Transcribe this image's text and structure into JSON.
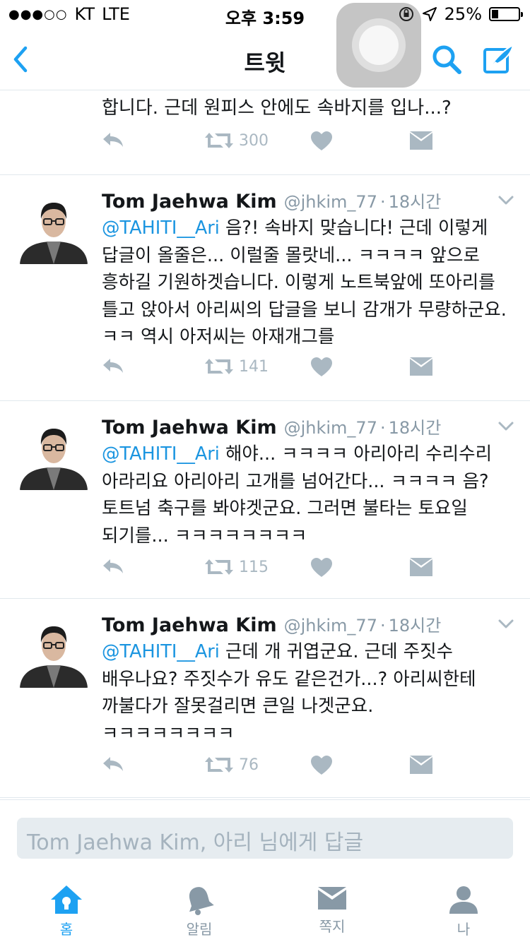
{
  "status_bar": {
    "signal": "●●●○○",
    "carrier": "KT",
    "network": "LTE",
    "time": "오후 3:59",
    "battery": "25%",
    "battery_level": 0.25
  },
  "nav": {
    "title": "트윗",
    "back_icon": "chevron-left-icon",
    "search_icon": "search-icon",
    "compose_icon": "compose-icon",
    "accent": "#1da1f2"
  },
  "partial_tweet": {
    "text": "합니다. 근데 원피스 안에도 속바지를 입나...?",
    "retweets": "300"
  },
  "tweets": [
    {
      "name": "Tom Jaehwa Kim",
      "handle": "@jhkim_77",
      "separator": "·",
      "time": "18시간",
      "mention": "@TAHITI__Ari",
      "body": " 음?! 속바지 맞습니다! 근데 이렇게 답글이 올줄은... 이럴줄 몰랏네... ㅋㅋㅋㅋ 앞으로 흥하길 기원하겟습니다. 이렇게 노트북앞에 또아리를 틀고 앉아서 아리씨의 답글을 보니 감개가 무량하군요. ㅋㅋ 역시 아저씨는 아재개그를",
      "retweets": "141"
    },
    {
      "name": "Tom Jaehwa Kim",
      "handle": "@jhkim_77",
      "separator": "·",
      "time": "18시간",
      "mention": "@TAHITI__Ari",
      "body": " 해야... ㅋㅋㅋㅋ 아리아리 수리수리 아라리요 아리아리 고개를 넘어간다... ㅋㅋㅋㅋ 음? 토트넘 축구를 봐야겟군요. 그러면 불타는 토요일 되기를... ㅋㅋㅋㅋㅋㅋㅋㅋ",
      "retweets": "115"
    },
    {
      "name": "Tom Jaehwa Kim",
      "handle": "@jhkim_77",
      "separator": "·",
      "time": "18시간",
      "mention": "@TAHITI__Ari",
      "body": " 근데 개 귀엽군요. 근데 주짓수 배우나요? 주짓수가 유도 같은건가...? 아리씨한테 까불다가 잘못걸리면 큰일 나겟군요. ㅋㅋㅋㅋㅋㅋㅋㅋ",
      "retweets": "76"
    }
  ],
  "reply_box": {
    "placeholder": "Tom Jaehwa Kim, 아리 님에게 답글"
  },
  "tabs": [
    {
      "label": "홈",
      "icon": "home-icon",
      "active": true
    },
    {
      "label": "알림",
      "icon": "bell-icon",
      "active": false
    },
    {
      "label": "쪽지",
      "icon": "envelope-icon",
      "active": false
    },
    {
      "label": "나",
      "icon": "person-icon",
      "active": false
    }
  ],
  "colors": {
    "accent": "#1da1f2",
    "mention": "#1b95e0",
    "muted": "#aab8c2",
    "divider": "#e1e8ed"
  }
}
